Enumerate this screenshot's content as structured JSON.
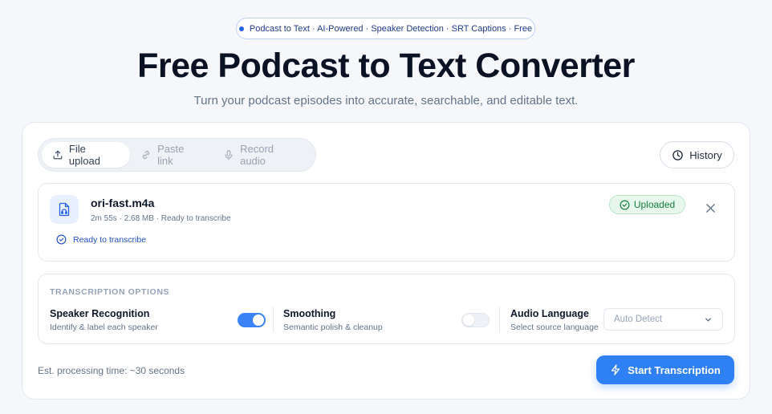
{
  "header": {
    "pill_text": "Podcast to Text · AI-Powered · Speaker Detection · SRT Captions · Free",
    "title": "Free Podcast to Text Converter",
    "subtitle": "Turn your podcast episodes into accurate, searchable, and editable text."
  },
  "tabs": [
    {
      "label": "File upload",
      "icon": "upload-icon",
      "active": true
    },
    {
      "label": "Paste link",
      "icon": "link-icon",
      "active": false
    },
    {
      "label": "Record audio",
      "icon": "microphone-icon",
      "active": false
    }
  ],
  "history": {
    "label": "History",
    "icon": "clock-icon"
  },
  "file": {
    "name": "ori-fast.m4a",
    "meta": "2m 55s · 2.68 MB · Ready to transcribe",
    "status_line": "Ready to transcribe",
    "badge": "Uploaded"
  },
  "options": {
    "heading": "TRANSCRIPTION OPTIONS",
    "speaker": {
      "title": "Speaker Recognition",
      "desc": "Identify & label each speaker",
      "enabled": true
    },
    "smoothing": {
      "title": "Smoothing",
      "desc": "Semantic polish & cleanup",
      "enabled": false
    },
    "language": {
      "title": "Audio Language",
      "desc": "Select source language",
      "selected": "Auto Detect"
    }
  },
  "footer": {
    "estimate": "Est. processing time: ~30 seconds",
    "start_label": "Start Transcription"
  },
  "colors": {
    "accent": "#2f80f5",
    "success": "#15803d",
    "link": "#1e4fc2"
  }
}
